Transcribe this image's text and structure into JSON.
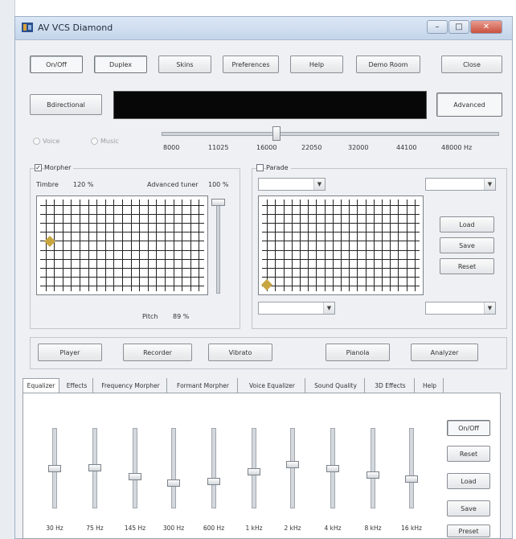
{
  "window": {
    "title": "AV VCS Diamond"
  },
  "top_buttons": [
    "On/Off",
    "Duplex",
    "Skins",
    "Preferences",
    "Help",
    "Demo Room",
    "Close"
  ],
  "display_row": {
    "left_button": "Bdirectional",
    "right_button": "Advanced"
  },
  "mode_radios": [
    "Voice",
    "Music"
  ],
  "pitch_scale": [
    "8000",
    "11025",
    "16000",
    "22050",
    "32000",
    "44100",
    "48000 Hz"
  ],
  "pitch_slider_value": 0.34,
  "morpher": {
    "check_label": "Morpher",
    "checked": true,
    "timbre_label": "Timbre",
    "timbre_value": "120 %",
    "advanced_tuner_label": "Advanced tuner",
    "advanced_tuner_value": "100 %",
    "pitch_label": "Pitch",
    "pitch_value": "89 %"
  },
  "parade": {
    "check_label": "Parade",
    "checked": false
  },
  "side_buttons": [
    "Load",
    "Save",
    "Reset"
  ],
  "mid_buttons": [
    "Player",
    "Recorder",
    "Vibrato",
    "Pianola",
    "Analyzer"
  ],
  "tabs": [
    "Equalizer",
    "Effects",
    "Frequency Morpher",
    "Formant Morpher",
    "Voice Equalizer",
    "Sound Quality",
    "3D Effects",
    "Help"
  ],
  "eq_buttons": [
    "On/Off",
    "Reset",
    "Load",
    "Save",
    "Preset"
  ],
  "eq_bands": [
    {
      "label": "30 Hz",
      "level": 0.0
    },
    {
      "label": "75 Hz",
      "level": 0.03
    },
    {
      "label": "145 Hz",
      "level": -0.2
    },
    {
      "label": "300 Hz",
      "level": -0.36
    },
    {
      "label": "600 Hz",
      "level": -0.32
    },
    {
      "label": "1 kHz",
      "level": -0.08
    },
    {
      "label": "2 kHz",
      "level": 0.1
    },
    {
      "label": "4 kHz",
      "level": 0.0
    },
    {
      "label": "8 kHz",
      "level": -0.15
    },
    {
      "label": "16 kHz",
      "level": -0.26
    }
  ],
  "colors": {
    "display_bg": "#070707",
    "marker": "#c8a640",
    "grid_line": "#222222"
  }
}
